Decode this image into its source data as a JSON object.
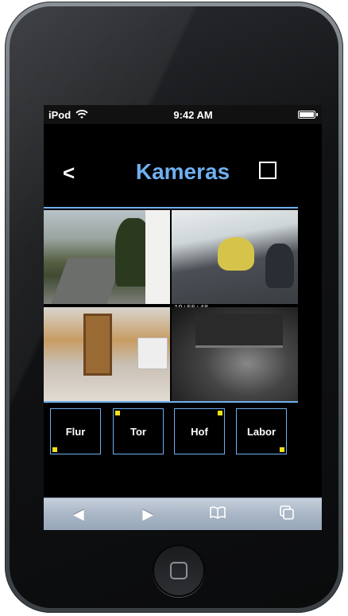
{
  "statusbar": {
    "carrier": "iPod",
    "time": "9:42 AM"
  },
  "header": {
    "back_label": "<",
    "title": "Kameras"
  },
  "cameras": {
    "timestamp": "19:55:48"
  },
  "camera_buttons": [
    {
      "label": "Flur"
    },
    {
      "label": "Tor"
    },
    {
      "label": "Hof"
    },
    {
      "label": "Labor"
    }
  ],
  "toolbar": {
    "back_icon": "◀",
    "forward_icon": "▶",
    "bookmarks_icon": "📖",
    "tabs_icon": "⧉"
  },
  "colors": {
    "accent": "#6fb0f0",
    "indicator": "#f4e11a",
    "background": "#000000"
  }
}
